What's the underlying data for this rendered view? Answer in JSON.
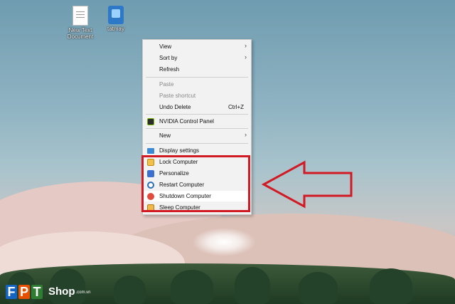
{
  "desktop_icons": [
    {
      "label_line1": "New Text",
      "label_line2": "Document",
      "icon": "text-document-icon"
    },
    {
      "label_line1": "tatmay",
      "label_line2": "",
      "icon": "app-shortcut-icon"
    }
  ],
  "context_menu": {
    "view": "View",
    "sort_by": "Sort by",
    "refresh": "Refresh",
    "paste": "Paste",
    "paste_shortcut": "Paste shortcut",
    "undo_delete": "Undo Delete",
    "undo_delete_shortcut": "Ctrl+Z",
    "nvidia": "NVIDIA Control Panel",
    "new": "New",
    "display_settings": "Display settings",
    "lock": "Lock Computer",
    "personalize": "Personalize",
    "restart": "Restart Computer",
    "shutdown": "Shutdown Computer",
    "sleep": "Sleep Computer",
    "submenu_arrow": "›"
  },
  "brand": {
    "letters": [
      "F",
      "P",
      "T"
    ],
    "colors": [
      "#1565c0",
      "#e65100",
      "#2e7d32"
    ],
    "shop": "Shop",
    "domain": ".com.vn"
  }
}
